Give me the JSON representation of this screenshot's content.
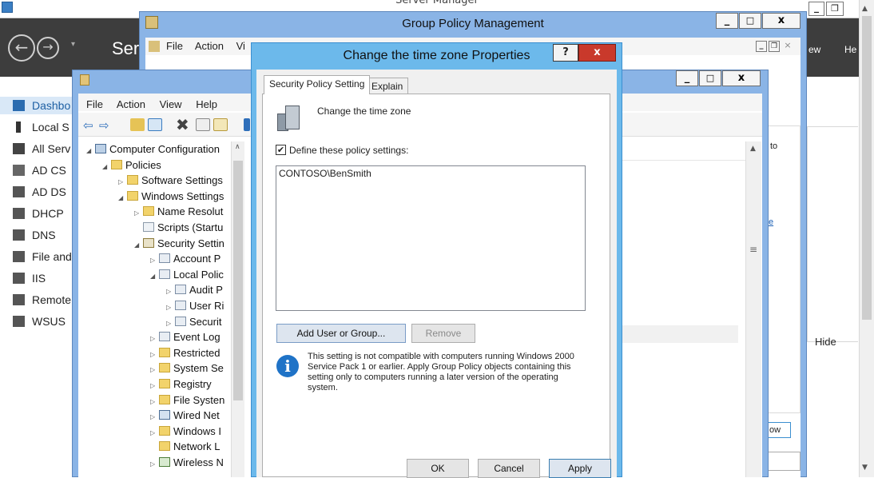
{
  "server_manager": {
    "title": "Server Manager",
    "header_title": "Ser",
    "header_menu": [
      "ew",
      "He"
    ],
    "hide_label": "Hide",
    "sidebar": [
      {
        "label": "Dashbo",
        "icon": "dashboard-icon",
        "active": true
      },
      {
        "label": "Local S",
        "icon": "local-server-icon"
      },
      {
        "label": "All Serv",
        "icon": "all-servers-icon"
      },
      {
        "label": "AD CS",
        "icon": "ad-cs-icon"
      },
      {
        "label": "AD DS",
        "icon": "ad-ds-icon"
      },
      {
        "label": "DHCP",
        "icon": "dhcp-icon"
      },
      {
        "label": "DNS",
        "icon": "dns-icon"
      },
      {
        "label": "File and",
        "icon": "file-services-icon"
      },
      {
        "label": "IIS",
        "icon": "iis-icon"
      },
      {
        "label": "Remote",
        "icon": "remote-access-icon"
      },
      {
        "label": "WSUS",
        "icon": "wsus-icon"
      }
    ],
    "right_snips": {
      "to": "to",
      "e": "e",
      "ow": "ow"
    }
  },
  "gpm": {
    "title": "Group Policy Management",
    "menu": [
      "File",
      "Action",
      "Vi"
    ],
    "min": "_",
    "max": "□",
    "close": "x"
  },
  "gpe": {
    "menu": [
      "File",
      "Action",
      "View",
      "Help"
    ],
    "tree": [
      {
        "label": "Computer Configuration",
        "icon": "computer-config-icon",
        "twisty": "◢",
        "indent": 0
      },
      {
        "label": "Policies",
        "icon": "folder-icon",
        "twisty": "◢",
        "indent": 1
      },
      {
        "label": "Software Settings",
        "icon": "folder-icon",
        "twisty": "▷",
        "indent": 2
      },
      {
        "label": "Windows Settings",
        "icon": "folder-icon",
        "twisty": "◢",
        "indent": 2
      },
      {
        "label": "Name Resolut",
        "icon": "folder-icon",
        "twisty": "▷",
        "indent": 3
      },
      {
        "label": "Scripts (Startu",
        "icon": "scripts-icon",
        "twisty": "",
        "indent": 3
      },
      {
        "label": "Security Settin",
        "icon": "security-settings-icon",
        "twisty": "◢",
        "indent": 3
      },
      {
        "label": "Account P",
        "icon": "policy-icon",
        "twisty": "▷",
        "indent": 4
      },
      {
        "label": "Local Polic",
        "icon": "policy-icon",
        "twisty": "◢",
        "indent": 4
      },
      {
        "label": "Audit P",
        "icon": "policy-icon",
        "twisty": "▷",
        "indent": 5
      },
      {
        "label": "User Ri",
        "icon": "policy-icon",
        "twisty": "▷",
        "indent": 5
      },
      {
        "label": "Securit",
        "icon": "policy-icon",
        "twisty": "▷",
        "indent": 5
      },
      {
        "label": "Event Log",
        "icon": "policy-icon",
        "twisty": "▷",
        "indent": 4
      },
      {
        "label": "Restricted",
        "icon": "folder-lock-icon",
        "twisty": "▷",
        "indent": 4
      },
      {
        "label": "System Se",
        "icon": "folder-lock-icon",
        "twisty": "▷",
        "indent": 4
      },
      {
        "label": "Registry",
        "icon": "folder-lock-icon",
        "twisty": "▷",
        "indent": 4
      },
      {
        "label": "File Systen",
        "icon": "folder-lock-icon",
        "twisty": "▷",
        "indent": 4
      },
      {
        "label": "Wired Net",
        "icon": "wired-network-icon",
        "twisty": "▷",
        "indent": 4
      },
      {
        "label": "Windows I",
        "icon": "folder-icon",
        "twisty": "▷",
        "indent": 4
      },
      {
        "label": "Network L",
        "icon": "folder-icon",
        "twisty": "",
        "indent": 4
      },
      {
        "label": "Wireless N",
        "icon": "wireless-network-icon",
        "twisty": "▷",
        "indent": 4
      }
    ]
  },
  "dialog": {
    "title": "Change the time zone Properties",
    "help": "?",
    "close": "x",
    "tabs": [
      "Security Policy Setting",
      "Explain"
    ],
    "policy_name": "Change the time zone",
    "define_label": "Define these policy settings:",
    "define_checked": true,
    "members": [
      "CONTOSO\\BenSmith"
    ],
    "add_button": "Add User or Group...",
    "remove_button": "Remove",
    "info_text": "This setting is not compatible with computers running Windows 2000 Service Pack 1 or earlier.  Apply Group Policy objects containing this setting only to computers running a later version of the operating system.",
    "ok": "OK",
    "cancel": "Cancel",
    "apply": "Apply"
  },
  "colors": {
    "dialog_frame": "#6cb9eb",
    "window_frame": "#8ab4e6",
    "header_dark": "#3d3d3d",
    "selected": "#d9e8f7"
  }
}
